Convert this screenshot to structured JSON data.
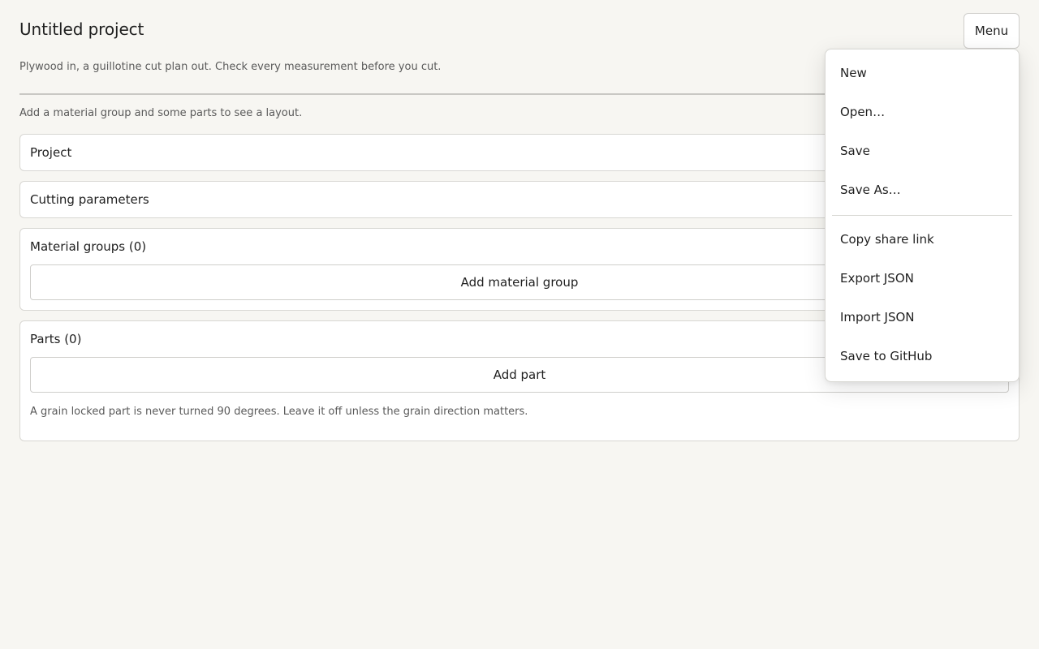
{
  "header": {
    "title": "Untitled project",
    "subtitle": "Plywood in, a guillotine cut plan out. Check every measurement before you cut.",
    "menu_label": "Menu"
  },
  "layout_hint": "Add a material group and some parts to see a layout.",
  "sections": {
    "project": {
      "title": "Project"
    },
    "cutting": {
      "title": "Cutting parameters"
    },
    "materials": {
      "title": "Material groups (0)",
      "add_label": "Add material group"
    },
    "parts": {
      "title": "Parts (0)",
      "add_label": "Add part",
      "note": "A grain locked part is never turned 90 degrees. Leave it off unless the grain direction matters."
    }
  },
  "menu": {
    "items": [
      {
        "label": "New"
      },
      {
        "label": "Open…"
      },
      {
        "label": "Save"
      },
      {
        "label": "Save As…"
      },
      {
        "label": "Copy share link"
      },
      {
        "label": "Export JSON"
      },
      {
        "label": "Import JSON"
      },
      {
        "label": "Save to GitHub"
      }
    ]
  }
}
